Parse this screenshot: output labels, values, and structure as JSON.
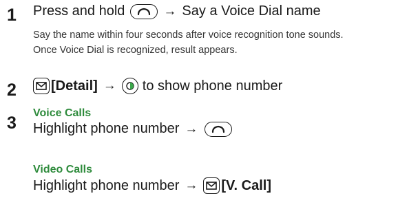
{
  "steps": {
    "s1": {
      "number": "1",
      "line_a": "Press and hold",
      "line_b": "Say a Voice Dial name",
      "note_1": "Say the name within four seconds after voice recognition tone sounds.",
      "note_2": "Once Voice Dial is recognized, result appears."
    },
    "s2": {
      "number": "2",
      "detail": "[Detail]",
      "text": "to show phone number"
    },
    "s3": {
      "number": "3",
      "voice_heading": "Voice Calls",
      "voice_text": "Highlight phone number",
      "video_heading": "Video Calls",
      "video_text": "Highlight phone number",
      "vcall": "[V. Call]"
    }
  },
  "arrow": "→",
  "colors": {
    "heading": "#2e8b3c",
    "nav_accent": "#3aa64a",
    "text": "#1a1a1a"
  }
}
